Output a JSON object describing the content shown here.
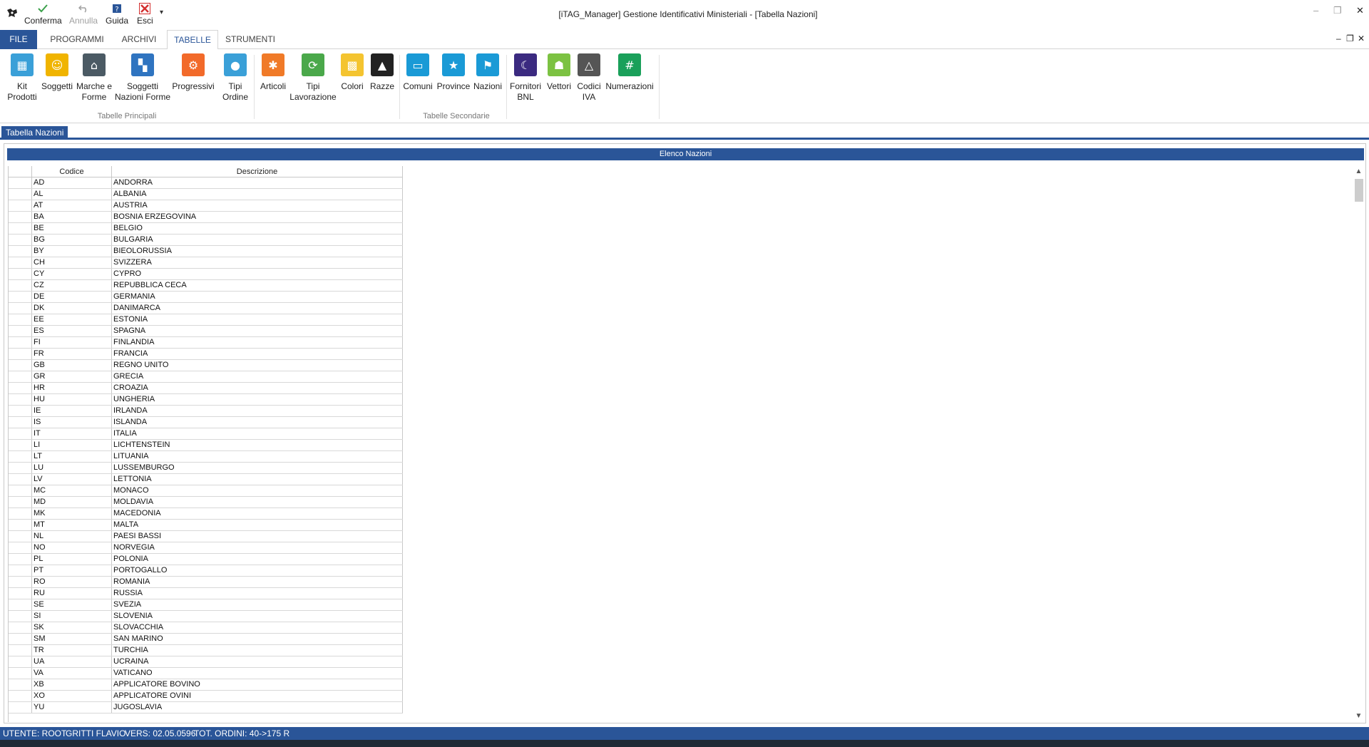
{
  "window": {
    "title": "[iTAG_Manager] Gestione Identificativi Ministeriali - [Tabella Nazioni]"
  },
  "quick_access": {
    "confirm_label": "Conferma",
    "undo_label": "Annulla",
    "help_label": "Guida",
    "exit_label": "Esci",
    "more_glyph": "▾"
  },
  "tabs": {
    "file": "FILE",
    "programmi": "PROGRAMMI",
    "archivi": "ARCHIVI",
    "tabelle": "TABELLE",
    "strumenti": "STRUMENTI"
  },
  "ribbon": {
    "principali_label": "Tabelle Principali",
    "secondarie_label": "Tabelle Secondarie",
    "principali": [
      {
        "l1": "Kit",
        "l2": "Prodotti",
        "color": "#3aa0d8"
      },
      {
        "l1": "Soggetti",
        "l2": "",
        "color": "#f0b400"
      },
      {
        "l1": "Marche e",
        "l2": "Forme",
        "color": "#4b5a64"
      },
      {
        "l1": "Soggetti",
        "l2": "Nazioni Forme",
        "color": "#2f74c0"
      },
      {
        "l1": "Progressivi",
        "l2": "",
        "color": "#f26a2a"
      },
      {
        "l1": "Tipi",
        "l2": "Ordine",
        "color": "#3aa0d8"
      }
    ],
    "secondarie": [
      {
        "l1": "Articoli",
        "l2": "",
        "color": "#f07a28"
      },
      {
        "l1": "Tipi",
        "l2": "Lavorazione",
        "color": "#4aa84a"
      },
      {
        "l1": "Colori",
        "l2": "",
        "color": "#f4c430"
      },
      {
        "l1": "Razze",
        "l2": "",
        "color": "#222222"
      },
      {
        "l1": "Comuni",
        "l2": "",
        "color": "#1a9ad6"
      },
      {
        "l1": "Province",
        "l2": "",
        "color": "#1a9ad6"
      },
      {
        "l1": "Nazioni",
        "l2": "",
        "color": "#1a9ad6"
      },
      {
        "l1": "Fornitori",
        "l2": "BNL",
        "color": "#3b2a80"
      },
      {
        "l1": "Vettori",
        "l2": "",
        "color": "#7cc242"
      },
      {
        "l1": "Codici",
        "l2": "IVA",
        "color": "#555555"
      },
      {
        "l1": "Numerazioni",
        "l2": "",
        "color": "#1aa05a"
      }
    ]
  },
  "document_tab": "Tabella Nazioni",
  "panel_title": "Elenco Nazioni",
  "grid": {
    "columns": [
      "Codice",
      "Descrizione"
    ],
    "rows": [
      [
        "AD",
        "ANDORRA"
      ],
      [
        "AL",
        "ALBANIA"
      ],
      [
        "AT",
        "AUSTRIA"
      ],
      [
        "BA",
        "BOSNIA ERZEGOVINA"
      ],
      [
        "BE",
        "BELGIO"
      ],
      [
        "BG",
        "BULGARIA"
      ],
      [
        "BY",
        "BIEOLORUSSIA"
      ],
      [
        "CH",
        "SVIZZERA"
      ],
      [
        "CY",
        "CYPRO"
      ],
      [
        "CZ",
        "REPUBBLICA CECA"
      ],
      [
        "DE",
        "GERMANIA"
      ],
      [
        "DK",
        "DANIMARCA"
      ],
      [
        "EE",
        "ESTONIA"
      ],
      [
        "ES",
        "SPAGNA"
      ],
      [
        "FI",
        "FINLANDIA"
      ],
      [
        "FR",
        "FRANCIA"
      ],
      [
        "GB",
        "REGNO UNITO"
      ],
      [
        "GR",
        "GRECIA"
      ],
      [
        "HR",
        "CROAZIA"
      ],
      [
        "HU",
        "UNGHERIA"
      ],
      [
        "IE",
        "IRLANDA"
      ],
      [
        "IS",
        "ISLANDA"
      ],
      [
        "IT",
        "ITALIA"
      ],
      [
        "LI",
        "LICHTENSTEIN"
      ],
      [
        "LT",
        "LITUANIA"
      ],
      [
        "LU",
        "LUSSEMBURGO"
      ],
      [
        "LV",
        "LETTONIA"
      ],
      [
        "MC",
        "MONACO"
      ],
      [
        "MD",
        "MOLDAVIA"
      ],
      [
        "MK",
        "MACEDONIA"
      ],
      [
        "MT",
        "MALTA"
      ],
      [
        "NL",
        "PAESI BASSI"
      ],
      [
        "NO",
        "NORVEGIA"
      ],
      [
        "PL",
        "POLONIA"
      ],
      [
        "PT",
        "PORTOGALLO"
      ],
      [
        "RO",
        "ROMANIA"
      ],
      [
        "RU",
        "RUSSIA"
      ],
      [
        "SE",
        "SVEZIA"
      ],
      [
        "SI",
        "SLOVENIA"
      ],
      [
        "SK",
        "SLOVACCHIA"
      ],
      [
        "SM",
        "SAN MARINO"
      ],
      [
        "TR",
        "TURCHIA"
      ],
      [
        "UA",
        "UCRAINA"
      ],
      [
        "VA",
        "VATICANO"
      ],
      [
        "XB",
        "APPLICATORE BOVINO"
      ],
      [
        "XO",
        "APPLICATORE OVINI"
      ],
      [
        "YU",
        "JUGOSLAVIA"
      ]
    ]
  },
  "status": {
    "user": "UTENTE: ROOT",
    "name": "GRITTI FLAVIO",
    "version": "VERS: 02.05.0596",
    "orders": "TOT. ORDINI: 40->175 R"
  },
  "colors": {
    "accent": "#2a5598"
  }
}
